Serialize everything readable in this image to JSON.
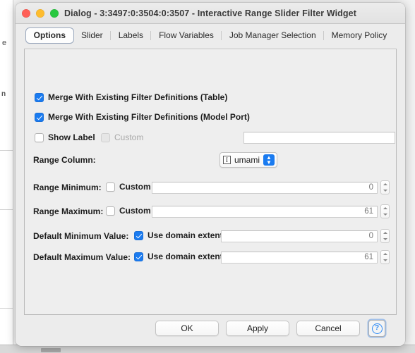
{
  "background": {
    "fragment_top": "e",
    "fragment_mid": "n"
  },
  "window": {
    "title": "Dialog - 3:3497:0:3504:0:3507 - Interactive Range Slider Filter Widget",
    "traffic_lights": {
      "close": "close-button",
      "minimize": "minimize-button",
      "maximize": "maximize-button"
    }
  },
  "tabs": [
    {
      "label": "Options",
      "selected": true
    },
    {
      "label": "Slider",
      "selected": false
    },
    {
      "label": "Labels",
      "selected": false
    },
    {
      "label": "Flow Variables",
      "selected": false
    },
    {
      "label": "Job Manager Selection",
      "selected": false
    },
    {
      "label": "Memory Policy",
      "selected": false
    }
  ],
  "options": {
    "merge_table": {
      "label": "Merge With Existing Filter Definitions (Table)",
      "checked": true
    },
    "merge_model_port": {
      "label": "Merge With Existing Filter Definitions (Model Port)",
      "checked": true
    },
    "show_label": {
      "label": "Show Label",
      "checked": false
    },
    "show_label_custom": {
      "label": "Custom",
      "checked": false,
      "disabled": true
    },
    "label_text_field": {
      "value": "",
      "placeholder": ""
    },
    "range_column": {
      "label": "Range Column:",
      "icon": "integer-column-icon",
      "icon_glyph": "I",
      "value": "umami"
    },
    "range_minimum": {
      "label": "Range Minimum:",
      "custom_label": "Custom",
      "custom_checked": false,
      "value": "0"
    },
    "range_maximum": {
      "label": "Range Maximum:",
      "custom_label": "Custom",
      "custom_checked": false,
      "value": "61"
    },
    "default_minimum": {
      "label": "Default Minimum Value:",
      "domain_label": "Use domain extent",
      "domain_checked": true,
      "value": "0"
    },
    "default_maximum": {
      "label": "Default Maximum Value:",
      "domain_label": "Use domain extent",
      "domain_checked": true,
      "value": "61"
    }
  },
  "footer": {
    "ok": "OK",
    "apply": "Apply",
    "cancel": "Cancel",
    "help": "?"
  },
  "colors": {
    "accent_blue": "#1a7bf0",
    "help_blue": "#2f8bf5",
    "window_bg": "#ececec",
    "panel_bg": "#eeeeee"
  }
}
